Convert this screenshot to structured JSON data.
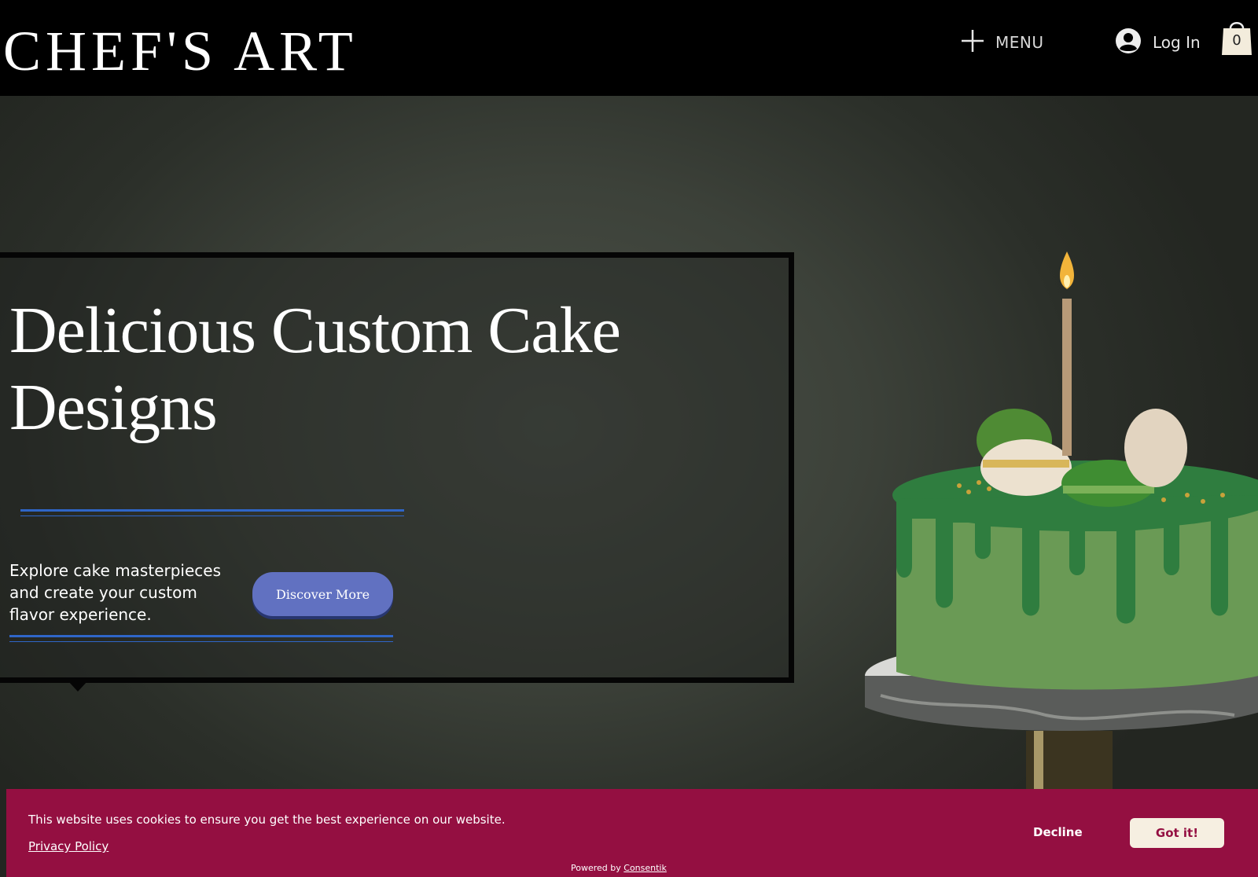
{
  "header": {
    "logo": "CHEF'S ART",
    "menu_label": "MENU",
    "login_label": "Log In",
    "cart_count": "0"
  },
  "hero": {
    "title": "Delicious Custom Cake Designs",
    "text": "Explore cake masterpieces and create your custom flavor experience.",
    "button_label": "Discover More",
    "background_image": "green drip cake with macarons and a lit candle on a marble stand"
  },
  "cookie_banner": {
    "message": "This website uses cookies to ensure you get the best experience on our website.",
    "privacy_link": "Privacy Policy",
    "decline_label": "Decline",
    "accept_label": "Got it!",
    "powered_by_prefix": "Powered by",
    "powered_by_link": "Consentik"
  },
  "colors": {
    "header_bg": "#000000",
    "accent_blue": "#2f66c8",
    "button_bg": "#6171c1",
    "cookie_bg": "#940f41",
    "accept_bg": "#f6efe1"
  },
  "icons": [
    "plus-icon",
    "user-avatar-icon",
    "shopping-bag-icon"
  ]
}
